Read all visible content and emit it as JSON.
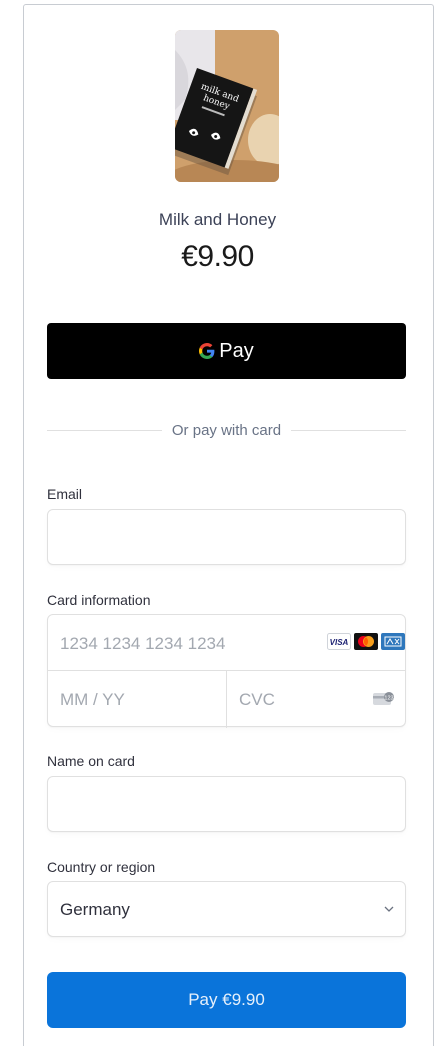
{
  "product": {
    "name": "Milk and Honey",
    "price": "€9.90",
    "image_icon": "book-cover-image",
    "cover_title_line1": "milk and",
    "cover_title_line2": "honey"
  },
  "gpay": {
    "label": "Pay",
    "icon": "google-g-icon"
  },
  "divider_text": "Or pay with card",
  "email": {
    "label": "Email",
    "value": ""
  },
  "card": {
    "label": "Card information",
    "number_placeholder": "1234 1234 1234 1234",
    "expiry_placeholder": "MM / YY",
    "cvc_placeholder": "CVC",
    "brands": [
      "visa-icon",
      "mastercard-icon",
      "amex-icon"
    ]
  },
  "name_on_card": {
    "label": "Name on card",
    "value": ""
  },
  "country": {
    "label": "Country or region",
    "value": "Germany"
  },
  "pay_button": {
    "label": "Pay €9.90"
  },
  "colors": {
    "pay_button": "#0a74da",
    "gpay_button": "#000000"
  }
}
